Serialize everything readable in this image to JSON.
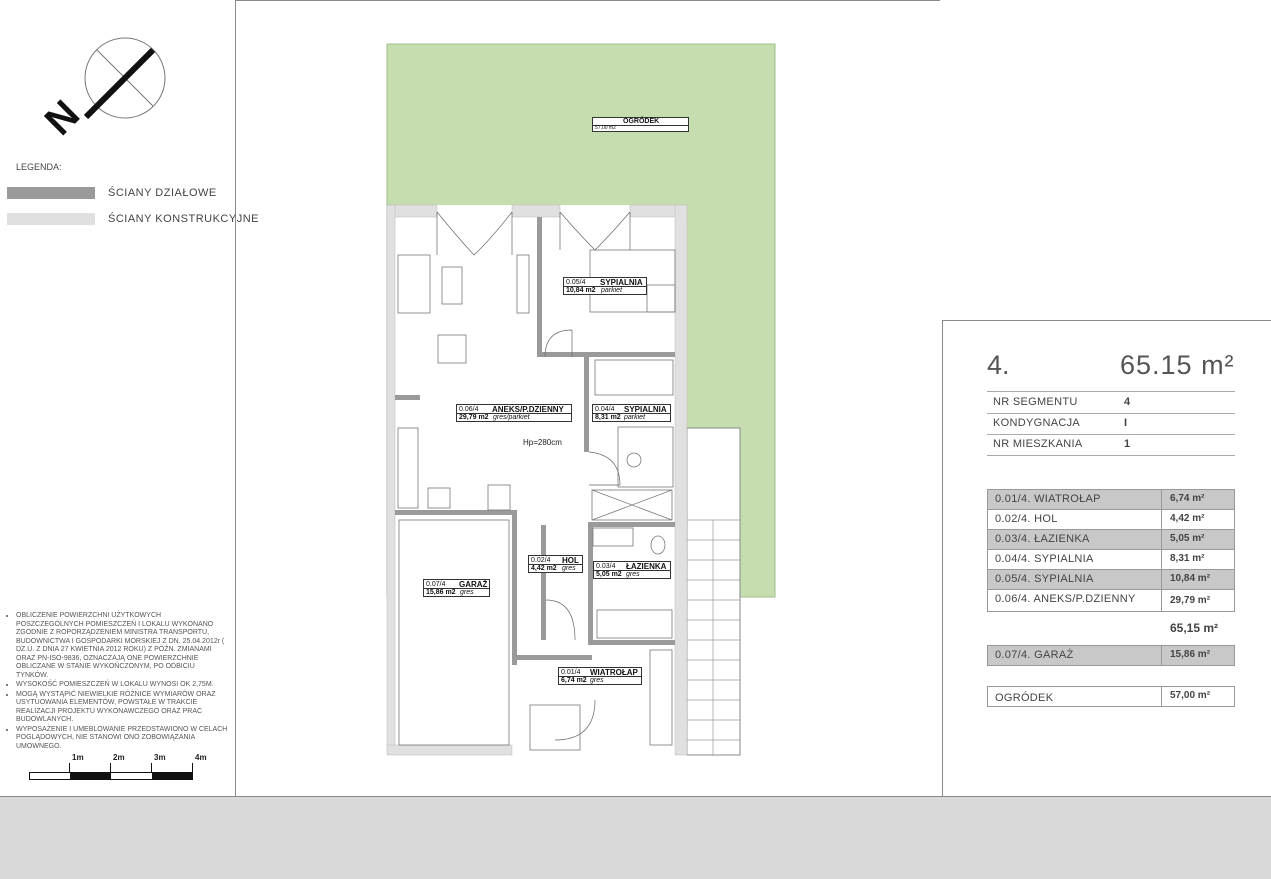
{
  "legend": {
    "title": "LEGENDA:",
    "items": [
      {
        "label": "ŚCIANY DZIAŁOWE",
        "color": "#9a9a9a"
      },
      {
        "label": "ŚCIANY KONSTRUKCYJNE",
        "color": "#e0e0e0"
      }
    ]
  },
  "compass": {
    "north_letter": "N"
  },
  "notes": [
    "OBLICZENIE POWIERZCHNI UŻYTKOWYCH POSZCZEGÓLNYCH POMIESZCZEŃ I LOKALU WYKONANO ZGODNIE Z ROPORZĄDZENIEM MINISTRA TRANSPORTU, BUDOWNICTWA I GOSPODARKI MORSKIEJ Z DN. 25.04.2012r ( DZ.U. Z DNIA 27 KWIETNIA 2012 ROKU) Z PÓŹN. ZMIANAMI ORAZ PN-ISO-9836, OZNACZAJĄ ONE POWIERZCHNIE OBLICZANE W STANIE WYKOŃCZONYM, PO ODBICIU TYNKÓW.",
    "WYSOKOŚĆ POMIESZCZEŃ W LOKALU WYNOSI OK 2,75M.",
    "MOGĄ WYSTĄPIĆ NIEWIELKIE RÓŻNICE WYMIARÓW ORAZ USYTUOWANIA ELEMENTÓW, POWSTAŁE W TRAKCIE REALIZACJI PROJEKTU WYKONAWCZEGO ORAZ PRAC BUDOWLANYCH.",
    "WYPOSAŻENIE I UMEBLOWANIE PRZEDSTAWIONO W CELACH POGLĄDOWYCH, NIE STANOWI ONO ZOBOWIĄZANIA UMOWNEGO."
  ],
  "scale": {
    "labels": [
      "1m",
      "2m",
      "3m",
      "4m"
    ]
  },
  "plan": {
    "height_label": "Hp=280cm",
    "garden": {
      "name": "OGRÓDEK",
      "area": "57,00 m2"
    },
    "rooms": [
      {
        "code": "0.05/4",
        "name": "SYPIALNIA",
        "area": "10,84 m2",
        "finish": "parkiet"
      },
      {
        "code": "0.06/4",
        "name": "ANEKS/P.DZIENNY",
        "area": "29,79 m2",
        "finish": "gres/parkiet"
      },
      {
        "code": "0.04/4",
        "name": "SYPIALNIA",
        "area": "8,31 m2",
        "finish": "parkiet"
      },
      {
        "code": "0.02/4",
        "name": "HOL",
        "area": "4,42 m2",
        "finish": "gres"
      },
      {
        "code": "0.03/4",
        "name": "ŁAZIENKA",
        "area": "5,05 m2",
        "finish": "gres"
      },
      {
        "code": "0.07/4",
        "name": "GARAŻ",
        "area": "15,86 m2",
        "finish": "gres"
      },
      {
        "code": "0.01/4",
        "name": "WIATROŁAP",
        "area": "6,74 m2",
        "finish": "gres"
      }
    ]
  },
  "summary": {
    "apartment_number": "4.",
    "total_area": "65.15 m²",
    "info": [
      {
        "key": "NR SEGMENTU",
        "value": "4"
      },
      {
        "key": "KONDYGNACJA",
        "value": "I"
      },
      {
        "key": "NR MIESZKANIA",
        "value": "1"
      }
    ],
    "rooms": [
      {
        "name": "0.01/4. WIATROŁAP",
        "area": "6,74 m²"
      },
      {
        "name": "0.02/4. HOL",
        "area": "4,42 m²"
      },
      {
        "name": "0.03/4. ŁAZIENKA",
        "area": "5,05 m²"
      },
      {
        "name": "0.04/4. SYPIALNIA",
        "area": "8,31 m²"
      },
      {
        "name": "0.05/4. SYPIALNIA",
        "area": "10,84 m²"
      },
      {
        "name": "0.06/4. ANEKS/P.DZIENNY",
        "area": "29,79 m²"
      }
    ],
    "rooms_total": "65,15 m²",
    "garage": {
      "name": "0.07/4. GARAŻ",
      "area": "15,86 m²"
    },
    "garden": {
      "name": "OGRÓDEK",
      "area": "57,00 m²"
    }
  }
}
